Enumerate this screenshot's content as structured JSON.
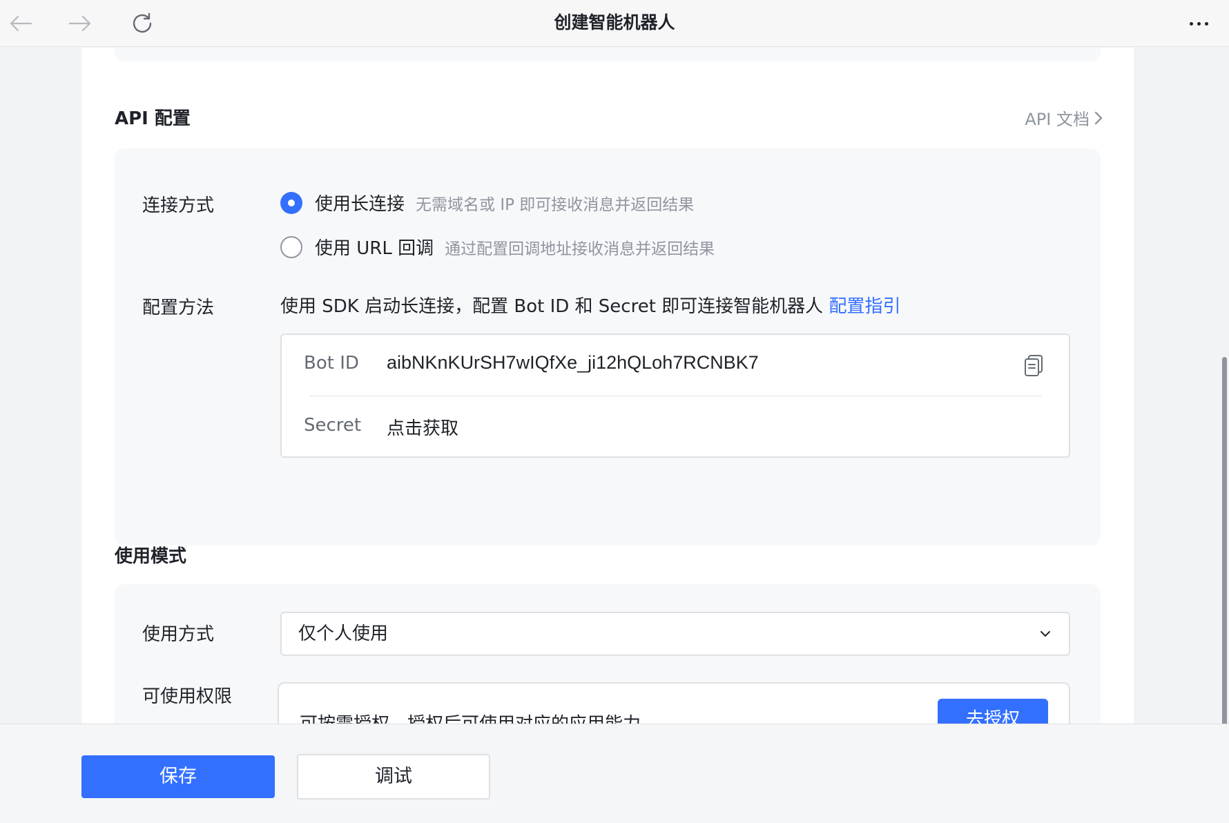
{
  "window": {
    "title": "创建智能机器人",
    "icons": {
      "back": "back-arrow-icon",
      "forward": "forward-arrow-icon",
      "refresh": "refresh-icon",
      "more": "more-dots-icon"
    }
  },
  "api_config": {
    "title": "API 配置",
    "doc_link": "API 文档",
    "connection": {
      "label": "连接方式",
      "options": [
        {
          "label": "使用长连接",
          "desc": "无需域名或 IP 即可接收消息并返回结果",
          "checked": true
        },
        {
          "label": "使用 URL 回调",
          "desc": "通过配置回调地址接收消息并返回结果",
          "checked": false
        }
      ]
    },
    "method": {
      "label": "配置方法",
      "text": "使用 SDK 启动长连接，配置 Bot ID 和 Secret 即可连接智能机器人",
      "guide_link": "配置指引"
    },
    "credentials": {
      "bot_id_label": "Bot ID",
      "bot_id_value": "aibNKnKUrSH7wIQfXe_ji12hQLoh7RCNBK7",
      "secret_label": "Secret",
      "secret_link": "点击获取"
    }
  },
  "usage_mode": {
    "title": "使用模式",
    "usage_label": "使用方式",
    "usage_value": "仅个人使用",
    "permission_label": "可使用权限",
    "permission_text": "可按需授权，授权后可使用对应的应用能力",
    "authorize_button": "去授权"
  },
  "footer": {
    "save_button": "保存",
    "debug_button": "调试"
  },
  "colors": {
    "accent": "#3370ff",
    "text_primary": "#1f2329",
    "text_secondary": "#8f959e",
    "panel_bg": "#f7f8fa",
    "border": "#dee0e3"
  }
}
